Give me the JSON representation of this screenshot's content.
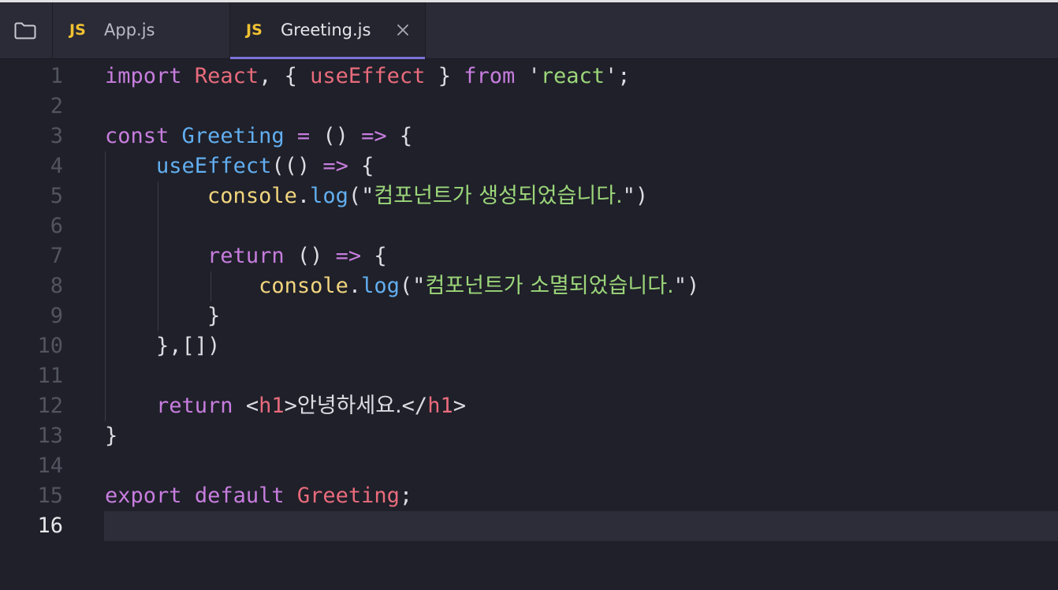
{
  "tabs": [
    {
      "badge": "JS",
      "label": "App.js",
      "active": false
    },
    {
      "badge": "JS",
      "label": "Greeting.js",
      "active": true
    }
  ],
  "icons": {
    "folder": "folder-icon",
    "close": "close-icon"
  },
  "colors": {
    "keyword": "#c77dde",
    "identifier": "#e96b7c",
    "string": "#9cd67a",
    "function": "#62aef0",
    "object": "#f2d57e",
    "active_tab_underline": "#7b73d6",
    "js_badge": "#f1c232"
  },
  "current_line": 16,
  "lines": [
    {
      "n": "1",
      "tokens": [
        {
          "t": "import",
          "c": "k"
        },
        {
          "t": " ",
          "c": "p"
        },
        {
          "t": "React",
          "c": "v"
        },
        {
          "t": ", { ",
          "c": "p"
        },
        {
          "t": "useEffect",
          "c": "v"
        },
        {
          "t": " } ",
          "c": "p"
        },
        {
          "t": "from",
          "c": "k"
        },
        {
          "t": " '",
          "c": "p"
        },
        {
          "t": "react",
          "c": "s"
        },
        {
          "t": "';",
          "c": "p"
        }
      ]
    },
    {
      "n": "2",
      "tokens": []
    },
    {
      "n": "3",
      "tokens": [
        {
          "t": "const",
          "c": "k"
        },
        {
          "t": " ",
          "c": "p"
        },
        {
          "t": "Greeting",
          "c": "f"
        },
        {
          "t": " ",
          "c": "p"
        },
        {
          "t": "=",
          "c": "o"
        },
        {
          "t": " () ",
          "c": "p"
        },
        {
          "t": "=>",
          "c": "o"
        },
        {
          "t": " {",
          "c": "p"
        }
      ]
    },
    {
      "n": "4",
      "tokens": [
        {
          "t": "    ",
          "c": "p"
        },
        {
          "t": "useEffect",
          "c": "f"
        },
        {
          "t": "(() ",
          "c": "p"
        },
        {
          "t": "=>",
          "c": "o"
        },
        {
          "t": " {",
          "c": "p"
        }
      ]
    },
    {
      "n": "5",
      "tokens": [
        {
          "t": "        ",
          "c": "p"
        },
        {
          "t": "console",
          "c": "y"
        },
        {
          "t": ".",
          "c": "p"
        },
        {
          "t": "log",
          "c": "f"
        },
        {
          "t": "(\"",
          "c": "p"
        },
        {
          "t": "컴포넌트가 생성되었습니다.",
          "c": "s ko"
        },
        {
          "t": "\")",
          "c": "p"
        }
      ]
    },
    {
      "n": "6",
      "tokens": []
    },
    {
      "n": "7",
      "tokens": [
        {
          "t": "        ",
          "c": "p"
        },
        {
          "t": "return",
          "c": "k"
        },
        {
          "t": " () ",
          "c": "p"
        },
        {
          "t": "=>",
          "c": "o"
        },
        {
          "t": " {",
          "c": "p"
        }
      ]
    },
    {
      "n": "8",
      "tokens": [
        {
          "t": "            ",
          "c": "p"
        },
        {
          "t": "console",
          "c": "y"
        },
        {
          "t": ".",
          "c": "p"
        },
        {
          "t": "log",
          "c": "f"
        },
        {
          "t": "(\"",
          "c": "p"
        },
        {
          "t": "컴포넌트가 소멸되었습니다.",
          "c": "s ko"
        },
        {
          "t": "\")",
          "c": "p"
        }
      ]
    },
    {
      "n": "9",
      "tokens": [
        {
          "t": "        }",
          "c": "p"
        }
      ]
    },
    {
      "n": "10",
      "tokens": [
        {
          "t": "    },[])",
          "c": "p"
        }
      ]
    },
    {
      "n": "11",
      "tokens": []
    },
    {
      "n": "12",
      "tokens": [
        {
          "t": "    ",
          "c": "p"
        },
        {
          "t": "return",
          "c": "k"
        },
        {
          "t": " <",
          "c": "p"
        },
        {
          "t": "h1",
          "c": "v"
        },
        {
          "t": ">",
          "c": "p"
        },
        {
          "t": "안녕하세요.",
          "c": "p ko"
        },
        {
          "t": "</",
          "c": "p"
        },
        {
          "t": "h1",
          "c": "v"
        },
        {
          "t": ">",
          "c": "p"
        }
      ]
    },
    {
      "n": "13",
      "tokens": [
        {
          "t": "}",
          "c": "p"
        }
      ]
    },
    {
      "n": "14",
      "tokens": []
    },
    {
      "n": "15",
      "tokens": [
        {
          "t": "export",
          "c": "k"
        },
        {
          "t": " ",
          "c": "p"
        },
        {
          "t": "default",
          "c": "k"
        },
        {
          "t": " ",
          "c": "p"
        },
        {
          "t": "Greeting",
          "c": "v"
        },
        {
          "t": ";",
          "c": "p"
        }
      ]
    },
    {
      "n": "16",
      "tokens": []
    }
  ]
}
